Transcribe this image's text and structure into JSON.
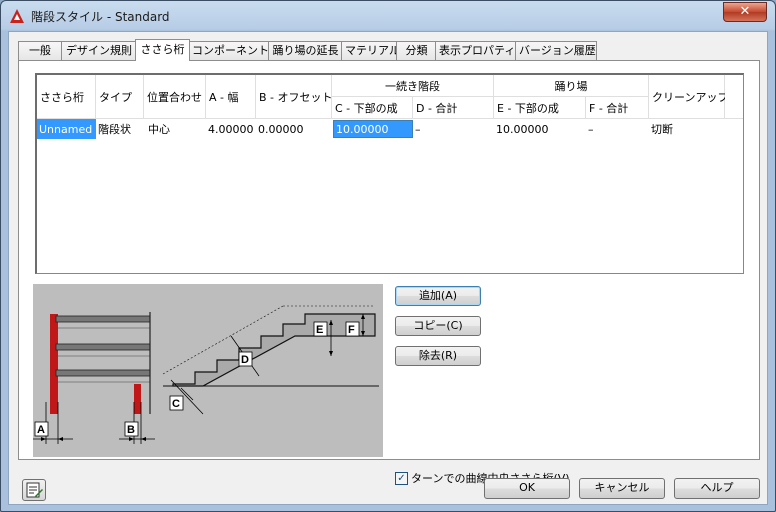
{
  "window": {
    "title": "階段スタイル - Standard",
    "close_glyph": "✕",
    "app_icon": "autocad-a-icon",
    "accent_color": "#c7472e"
  },
  "tabs": [
    {
      "label": "一般"
    },
    {
      "label": "デザイン規則"
    },
    {
      "label": "ささら桁"
    },
    {
      "label": "コンポーネント"
    },
    {
      "label": "踊り場の延長"
    },
    {
      "label": "マテリアル"
    },
    {
      "label": "分類"
    },
    {
      "label": "表示プロパティ"
    },
    {
      "label": "バージョン履歴"
    }
  ],
  "active_tab": "ささら桁",
  "grid": {
    "headers": {
      "stringer": "ささら桁",
      "type": "タイプ",
      "alignment": "位置合わせ",
      "width": "A - 幅",
      "offset": "B - オフセット",
      "flight_group": "一続き階段",
      "flight_waist": "C - 下部の成",
      "flight_total": "D - 合計",
      "landing_group": "踊り場",
      "landing_waist": "E - 下部の成",
      "landing_total": "F - 合計",
      "cleanup": "クリーンアップ"
    },
    "row": {
      "stringer": "Unnamed",
      "type": "階段状",
      "alignment": "中心",
      "width": "4.00000",
      "offset": "0.00000",
      "flight_waist": "10.00000",
      "flight_total": "–",
      "landing_waist": "10.00000",
      "landing_total": "–",
      "cleanup": "切断"
    }
  },
  "preview": {
    "labels": {
      "a": "A",
      "b": "B",
      "c": "C",
      "d": "D",
      "e": "E",
      "f": "F"
    }
  },
  "side_buttons": {
    "add": "追加(A)",
    "copy": "コピー(C)",
    "remove": "除去(R)"
  },
  "checkbox": {
    "label": "ターンでの曲線中央ささら桁(V)",
    "checked": true,
    "check_glyph": "✓"
  },
  "footer": {
    "ok": "OK",
    "cancel": "キャンセル",
    "help": "ヘルプ",
    "icon": "property-edit-icon"
  }
}
